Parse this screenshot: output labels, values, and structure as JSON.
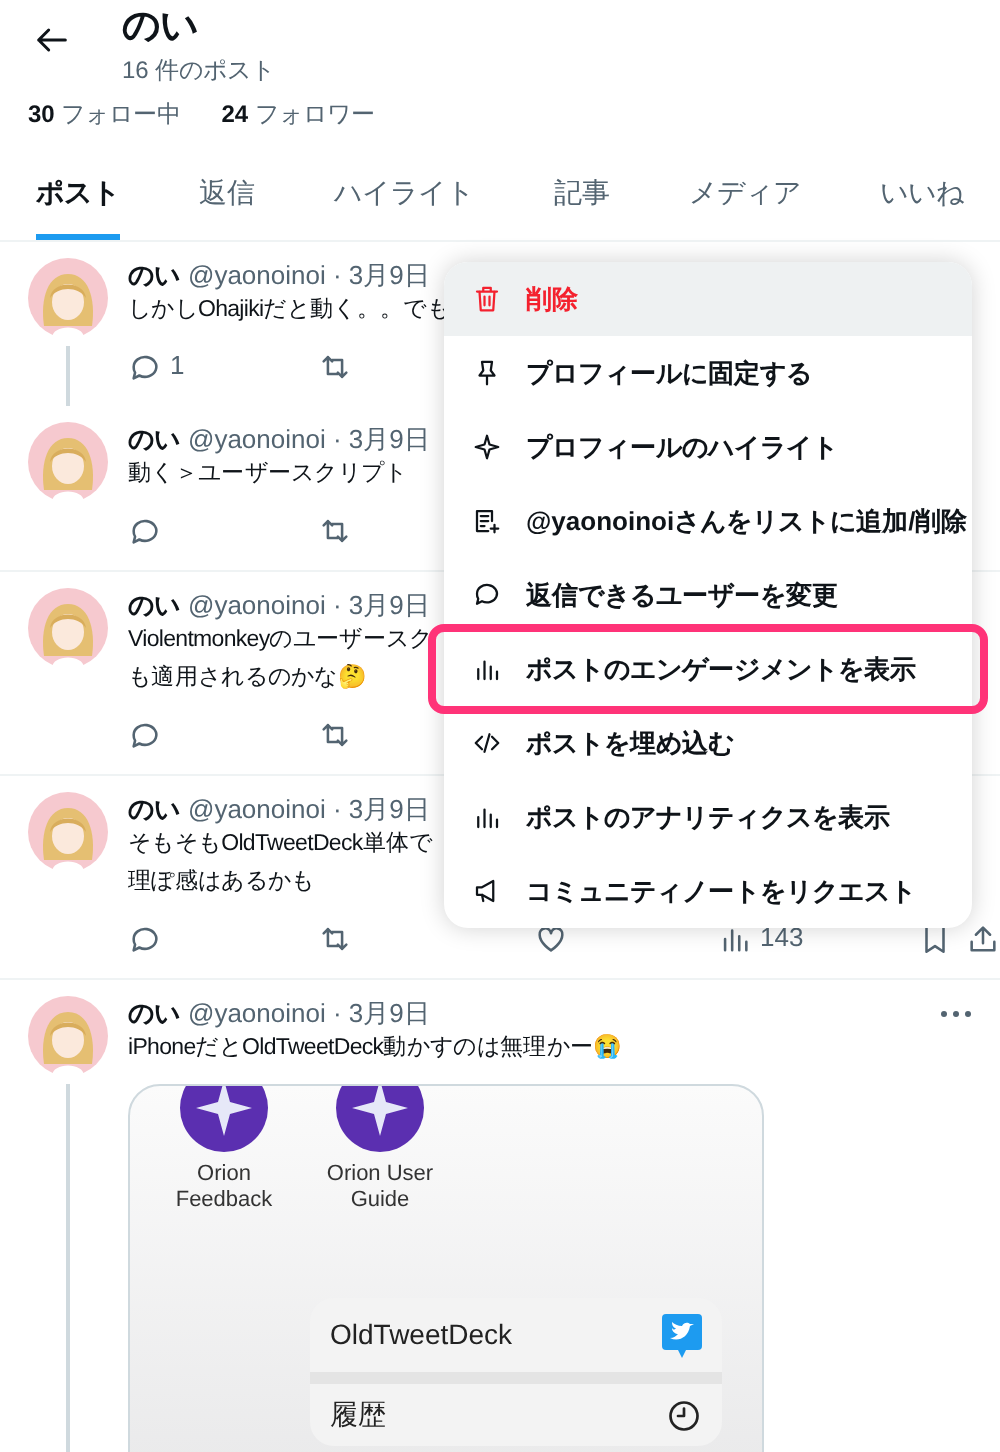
{
  "header": {
    "name": "のい",
    "post_count": "16 件のポスト"
  },
  "follow": [
    {
      "count": "30",
      "label": "フォロー中"
    },
    {
      "count": "24",
      "label": "フォロワー"
    }
  ],
  "tabs": [
    {
      "label": "ポスト",
      "selected": true
    },
    {
      "label": "返信",
      "selected": false
    },
    {
      "label": "ハイライト",
      "selected": false
    },
    {
      "label": "記事",
      "selected": false
    },
    {
      "label": "メディア",
      "selected": false
    },
    {
      "label": "いいね",
      "selected": false
    }
  ],
  "posts": [
    {
      "name": "のい",
      "handle": "@yaonoinoi · 3月9日",
      "lines": [
        "しかしOhajikiだと動く。。でも"
      ],
      "thread_below": true,
      "more": false,
      "actions": [
        {
          "kind": "reply",
          "count": "1"
        },
        {
          "kind": "retweet"
        }
      ]
    },
    {
      "name": "のい",
      "handle": "@yaonoinoi · 3月9日",
      "lines": [
        "動く＞ユーザースクリプト"
      ],
      "thread_below": false,
      "more": false,
      "actions": [
        {
          "kind": "reply"
        },
        {
          "kind": "retweet"
        }
      ]
    },
    {
      "name": "のい",
      "handle": "@yaonoinoi · 3月9日",
      "lines": [
        "Violentmonkeyのユーザースク",
        "も適用されるのかな🤔"
      ],
      "thread_below": false,
      "more": false,
      "actions": [
        {
          "kind": "reply"
        },
        {
          "kind": "retweet"
        }
      ]
    },
    {
      "name": "のい",
      "handle": "@yaonoinoi · 3月9日",
      "lines": [
        "そもそもOldTweetDeck単体で",
        "理ぽ感はあるかも"
      ],
      "thread_below": false,
      "more": false,
      "actions": [
        {
          "kind": "reply"
        },
        {
          "kind": "retweet"
        },
        {
          "kind": "like"
        },
        {
          "kind": "views",
          "count": "143"
        },
        {
          "kind": "bookmark"
        },
        {
          "kind": "share"
        }
      ]
    },
    {
      "name": "のい",
      "handle": "@yaonoinoi · 3月9日",
      "lines": [
        "iPhoneだとOldTweetDeck動かすのは無理かー😭"
      ],
      "thread_below": true,
      "more": true,
      "embed": {
        "apps": [
          {
            "label": "Orion Feedback"
          },
          {
            "label": "Orion User Guide"
          }
        ],
        "rows": [
          {
            "kind": "bird",
            "label": "OldTweetDeck"
          },
          {
            "kind": "clock",
            "label": "履歴"
          }
        ]
      }
    }
  ],
  "menu": [
    {
      "kind": "trash",
      "label": "削除",
      "danger": true,
      "hovered": true,
      "highlighted": false
    },
    {
      "kind": "pin",
      "label": "プロフィールに固定する",
      "danger": false,
      "hovered": false,
      "highlighted": false
    },
    {
      "kind": "sparkle",
      "label": "プロフィールのハイライト",
      "danger": false,
      "hovered": false,
      "highlighted": false
    },
    {
      "kind": "list",
      "label": "@yaonoinoiさんをリストに追加/削除",
      "danger": false,
      "hovered": false,
      "highlighted": false
    },
    {
      "kind": "bubble",
      "label": "返信できるユーザーを変更",
      "danger": false,
      "hovered": false,
      "highlighted": false
    },
    {
      "kind": "chart",
      "label": "ポストのエンゲージメントを表示",
      "danger": false,
      "hovered": false,
      "highlighted": true
    },
    {
      "kind": "code",
      "label": "ポストを埋め込む",
      "danger": false,
      "hovered": false,
      "highlighted": false
    },
    {
      "kind": "chart",
      "label": "ポストのアナリティクスを表示",
      "danger": false,
      "hovered": false,
      "highlighted": false
    },
    {
      "kind": "megaphone",
      "label": "コミュニティノートをリクエスト",
      "danger": false,
      "hovered": false,
      "highlighted": false
    }
  ]
}
